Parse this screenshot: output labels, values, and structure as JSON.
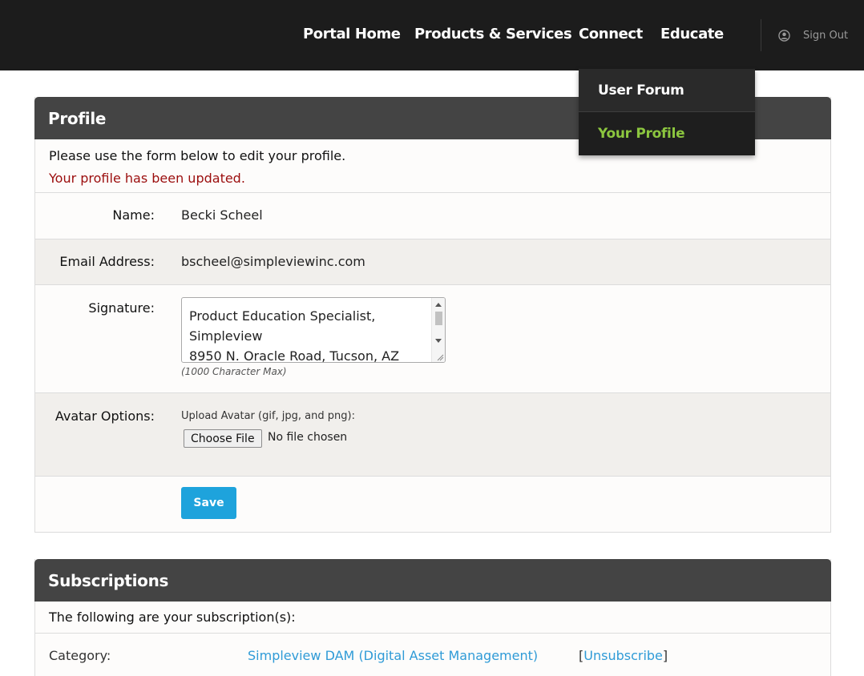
{
  "nav": {
    "items": [
      "Portal Home",
      "Products & Services",
      "Connect",
      "Educate"
    ],
    "signout": "Sign Out",
    "user_icon": "user-circle-icon"
  },
  "dropdown": {
    "items": [
      "User Forum",
      "Your Profile"
    ],
    "active_color": "#8cc63f"
  },
  "profile": {
    "title": "Profile",
    "intro": "Please use the form below to edit your profile.",
    "notice": "Your profile has been updated.",
    "name_label": "Name:",
    "name_value": "Becki Scheel",
    "email_label": "Email Address:",
    "email_value": "bscheel@simpleviewinc.com",
    "signature_label": "Signature:",
    "signature_value": "Product Education Specialist,\nSimpleview\n8950 N. Oracle Road, Tucson, AZ",
    "signature_hint": "(1000 Character Max)",
    "avatar_label": "Avatar Options:",
    "upload_label": "Upload Avatar (gif, jpg, and png):",
    "choose_file": "Choose File",
    "no_file": "No file chosen",
    "save": "Save"
  },
  "subscriptions": {
    "title": "Subscriptions",
    "intro": "The following are your subscription(s):",
    "rows": [
      {
        "category_label": "Category:",
        "category": "Simpleview DAM (Digital Asset Management)",
        "action": "Unsubscribe"
      }
    ]
  },
  "colors": {
    "header_bg": "#1c1c1c",
    "panel_head": "#444444",
    "notice": "#9b0d0d",
    "link": "#2f9bd7",
    "save_button": "#1ea3dc"
  }
}
